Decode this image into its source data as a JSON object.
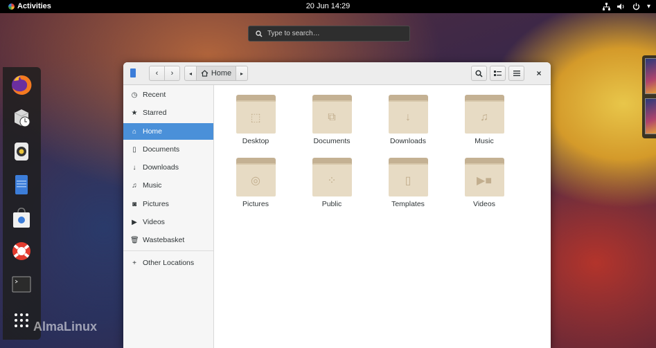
{
  "topbar": {
    "activities": "Activities",
    "clock": "20 Jun  14:29"
  },
  "search": {
    "placeholder": "Type to search…"
  },
  "brand": {
    "name": "AlmaLinux"
  },
  "dash": {
    "items": [
      {
        "name": "firefox-icon"
      },
      {
        "name": "software-icon"
      },
      {
        "name": "rhythmbox-icon"
      },
      {
        "name": "files-icon"
      },
      {
        "name": "software-bag-icon"
      },
      {
        "name": "help-icon"
      },
      {
        "name": "terminal-icon"
      },
      {
        "name": "show-apps-icon"
      }
    ]
  },
  "window": {
    "path": {
      "current": "Home"
    },
    "sidebar": {
      "items": [
        {
          "label": "Recent",
          "icon": "clock-icon"
        },
        {
          "label": "Starred",
          "icon": "star-icon"
        },
        {
          "label": "Home",
          "icon": "home-icon",
          "active": true
        },
        {
          "label": "Documents",
          "icon": "document-icon"
        },
        {
          "label": "Downloads",
          "icon": "download-icon"
        },
        {
          "label": "Music",
          "icon": "music-icon"
        },
        {
          "label": "Pictures",
          "icon": "camera-icon"
        },
        {
          "label": "Videos",
          "icon": "video-icon"
        },
        {
          "label": "Wastebasket",
          "icon": "trash-icon"
        }
      ],
      "other": {
        "label": "Other Locations",
        "icon": "plus-icon"
      }
    },
    "folders": [
      {
        "label": "Desktop",
        "icon": "desktop-icon"
      },
      {
        "label": "Documents",
        "icon": "documents-icon"
      },
      {
        "label": "Downloads",
        "icon": "downloads-icon"
      },
      {
        "label": "Music",
        "icon": "music-icon"
      },
      {
        "label": "Pictures",
        "icon": "pictures-icon"
      },
      {
        "label": "Public",
        "icon": "share-icon"
      },
      {
        "label": "Templates",
        "icon": "templates-icon"
      },
      {
        "label": "Videos",
        "icon": "videos-icon"
      }
    ]
  }
}
